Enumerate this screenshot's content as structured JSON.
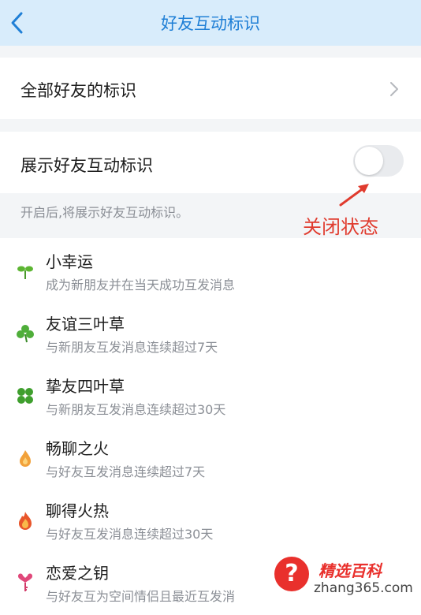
{
  "header": {
    "title": "好友互动标识"
  },
  "all_friends": {
    "label": "全部好友的标识"
  },
  "show_toggle": {
    "label": "展示好友互动标识",
    "enabled": false
  },
  "hint": "开启后,将展示好友互动标识。",
  "annotation": "关闭状态",
  "items": [
    {
      "title": "小幸运",
      "desc": "成为新朋友并在当天成功互发消息",
      "icon": "sprout-icon"
    },
    {
      "title": "友谊三叶草",
      "desc": "与新朋友互发消息连续超过7天",
      "icon": "three-leaf-clover-icon"
    },
    {
      "title": "挚友四叶草",
      "desc": "与新朋友互发消息连续超过30天",
      "icon": "four-leaf-clover-icon"
    },
    {
      "title": "畅聊之火",
      "desc": "与好友互发消息连续超过7天",
      "icon": "small-flame-icon"
    },
    {
      "title": "聊得火热",
      "desc": "与好友互发消息连续超过30天",
      "icon": "big-flame-icon"
    },
    {
      "title": "恋爱之钥",
      "desc": "与好友互为空间情侣且最近互发消",
      "icon": "heart-key-icon"
    }
  ],
  "watermark": {
    "title": "精选百科",
    "url": "zhang365.com"
  },
  "colors": {
    "accent": "#1f7fd6",
    "header_bg": "#d8ecfb",
    "annotation": "#e03b2e"
  }
}
